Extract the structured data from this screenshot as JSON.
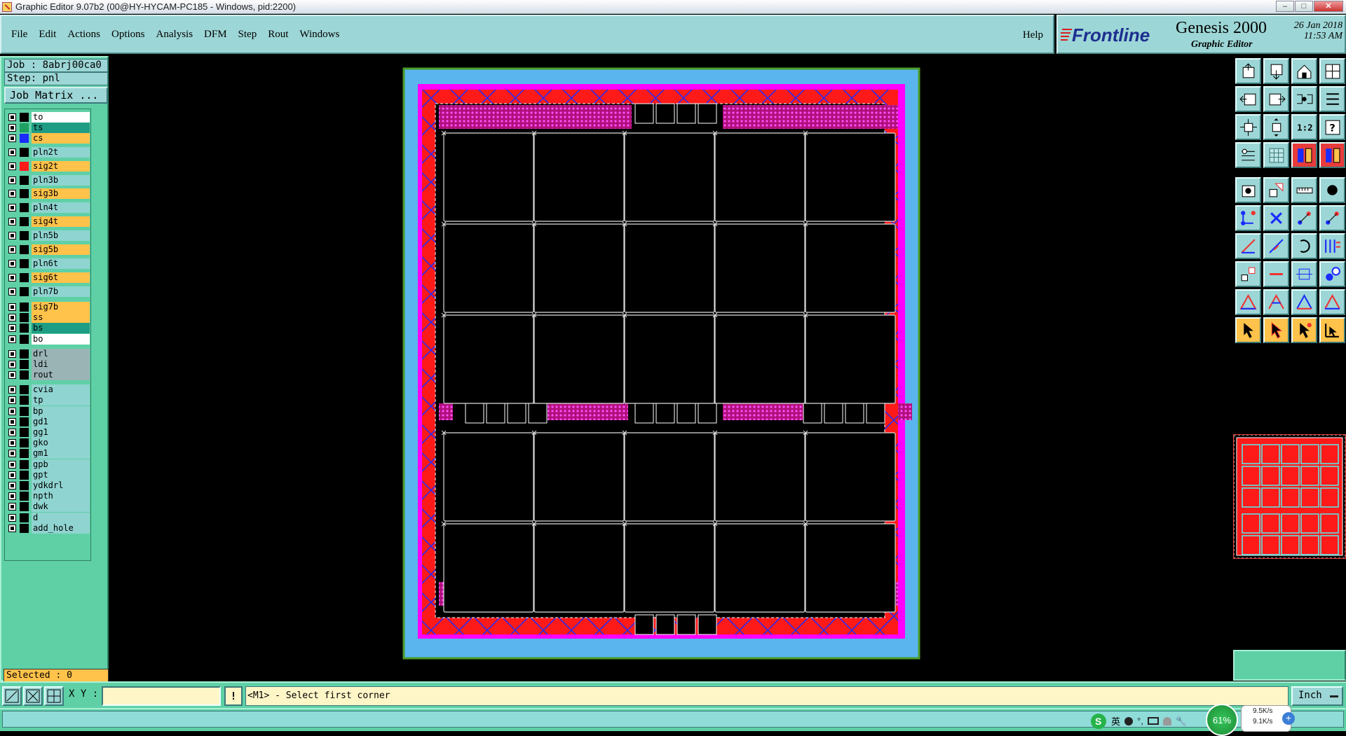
{
  "window": {
    "title": "Graphic Editor 9.07b2 (00@HY-HYCAM-PC185 - Windows, pid:2200)"
  },
  "menu": {
    "items": [
      "File",
      "Edit",
      "Actions",
      "Options",
      "Analysis",
      "DFM",
      "Step",
      "Rout",
      "Windows"
    ],
    "help": "Help"
  },
  "brand": {
    "logo": "Frontline",
    "product": "Genesis 2000",
    "subtitle": "Graphic Editor",
    "date": "26 Jan 2018",
    "time": "11:53 AM"
  },
  "job": {
    "job_label": "Job : 8abrj00ca0",
    "step_label": "Step: pnl",
    "matrix_button": "Job Matrix ..."
  },
  "layers": [
    {
      "name": "to",
      "ctx": "board",
      "swatch": "#000000"
    },
    {
      "name": "ts",
      "ctx": "sm",
      "swatch": "#1ea060"
    },
    {
      "name": "cs",
      "ctx": "sig",
      "swatch": "#1a2cff"
    },
    {
      "name": "pln2t",
      "ctx": "misc",
      "swatch": "#000000"
    },
    {
      "name": "sig2t",
      "ctx": "sig",
      "swatch": "#ff1a1a"
    },
    {
      "name": "pln3b",
      "ctx": "misc",
      "swatch": "#000000"
    },
    {
      "name": "sig3b",
      "ctx": "sig",
      "swatch": "#000000"
    },
    {
      "name": "pln4t",
      "ctx": "misc",
      "swatch": "#000000"
    },
    {
      "name": "sig4t",
      "ctx": "sig",
      "swatch": "#000000"
    },
    {
      "name": "pln5b",
      "ctx": "misc",
      "swatch": "#000000"
    },
    {
      "name": "sig5b",
      "ctx": "sig",
      "swatch": "#000000"
    },
    {
      "name": "pln6t",
      "ctx": "misc",
      "swatch": "#000000"
    },
    {
      "name": "sig6t",
      "ctx": "sig",
      "swatch": "#000000"
    },
    {
      "name": "pln7b",
      "ctx": "misc",
      "swatch": "#000000"
    },
    {
      "name": "sig7b",
      "ctx": "sig",
      "swatch": "#000000"
    },
    {
      "name": "ss",
      "ctx": "sig",
      "swatch": "#000000"
    },
    {
      "name": "bs",
      "ctx": "sm",
      "swatch": "#000000"
    },
    {
      "name": "bo",
      "ctx": "board",
      "swatch": "#000000"
    },
    {
      "name": "drl",
      "ctx": "drill",
      "swatch": "#000000"
    },
    {
      "name": "ldi",
      "ctx": "drill",
      "swatch": "#000000"
    },
    {
      "name": "rout",
      "ctx": "drill",
      "swatch": "#000000"
    },
    {
      "name": "cvia",
      "ctx": "misc",
      "swatch": "#000000"
    },
    {
      "name": "tp",
      "ctx": "misc",
      "swatch": "#000000"
    },
    {
      "name": "bp",
      "ctx": "misc",
      "swatch": "#000000"
    },
    {
      "name": "gd1",
      "ctx": "misc",
      "swatch": "#000000"
    },
    {
      "name": "gg1",
      "ctx": "misc",
      "swatch": "#000000"
    },
    {
      "name": "gko",
      "ctx": "misc",
      "swatch": "#000000"
    },
    {
      "name": "gm1",
      "ctx": "misc",
      "swatch": "#000000"
    },
    {
      "name": "gpb",
      "ctx": "misc",
      "swatch": "#000000"
    },
    {
      "name": "gpt",
      "ctx": "misc",
      "swatch": "#000000"
    },
    {
      "name": "ydkdrl",
      "ctx": "misc",
      "swatch": "#000000"
    },
    {
      "name": "npth",
      "ctx": "misc",
      "swatch": "#000000"
    },
    {
      "name": "dwk",
      "ctx": "misc",
      "swatch": "#000000"
    },
    {
      "name": "d",
      "ctx": "misc",
      "swatch": "#000000"
    },
    {
      "name": "add_hole",
      "ctx": "misc",
      "swatch": "#000000"
    }
  ],
  "selected": {
    "label": "Selected : 0"
  },
  "command": {
    "xy_label": "X Y :",
    "xy_value": "",
    "bang": "!",
    "prompt": "<M1> - Select first corner",
    "units": "Inch"
  },
  "tray": {
    "ime": "英",
    "cpu": "61%",
    "up": "9.5K/s",
    "down": "9.1K/s",
    "plus": "+"
  },
  "panel": {
    "rows": 5,
    "cols": 5,
    "row_groups": [
      3,
      2
    ]
  },
  "colors": {
    "accent_teal": "#9dd6d6",
    "panel_green": "#5fd0a6",
    "layer_yellow": "#ffc24a",
    "copper_red": "#ff1a1a",
    "frame_blue": "#5ab4ee"
  }
}
